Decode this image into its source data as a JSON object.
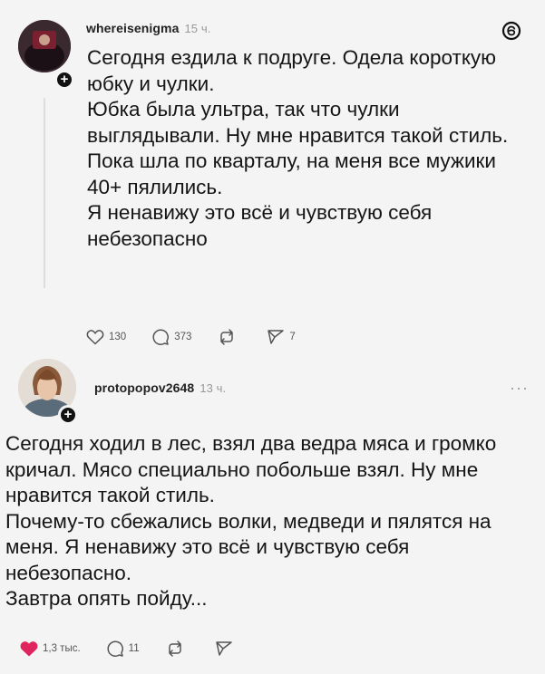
{
  "post1": {
    "username": "whereisenigma",
    "time": "15 ч.",
    "paragraphs": [
      "Сегодня ездила к подруге. Одела короткую юбку и чулки.",
      "Юбка была ультра, так что чулки выглядывали. Ну мне нравится такой стиль.",
      "Пока шла по кварталу, на меня все мужики 40+ пялились.",
      "Я ненавижу это всё и чувствую себя небезопасно"
    ],
    "likes": "130",
    "comments": "373",
    "shares": "7"
  },
  "post2": {
    "username": "protopopov2648",
    "time": "13 ч.",
    "more": "···",
    "paragraphs": [
      "Сегодня ходил в лес, взял два ведра мяса и громко кричал. Мясо специально побольше взял. Ну мне нравится такой стиль.",
      "Почему-то сбежались волки, медведи и пялятся на меня. Я ненавижу это всё и чувствую себя небезопасно.",
      "Завтра опять пойду..."
    ],
    "likes": "1,3 тыс.",
    "comments": "11"
  },
  "icons": [
    "threads-logo-icon",
    "plus-icon",
    "heart-icon",
    "comment-icon",
    "repost-icon",
    "share-icon",
    "more-icon"
  ],
  "colors": {
    "heart_liked": "#e0245e",
    "text": "#151515",
    "muted": "#999999"
  }
}
